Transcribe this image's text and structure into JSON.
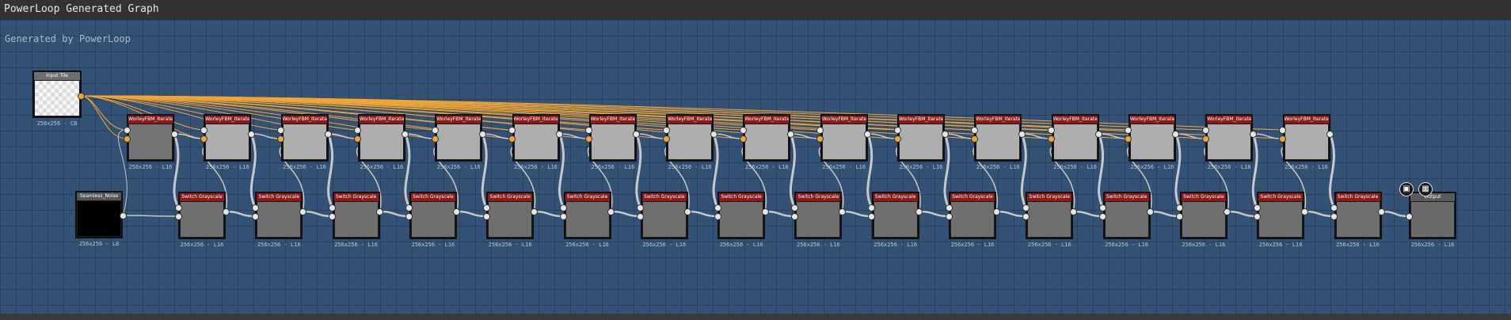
{
  "window": {
    "title": "PowerLoop Generated Graph"
  },
  "canvas": {
    "subtitle": "Generated by PowerLoop",
    "colors": {
      "background": "#345275",
      "blend_header": "#8b1a1a",
      "wire_orange": "#f2a533",
      "wire_gray": "#c8c8c8"
    }
  },
  "input_node": {
    "header": "Input Tile",
    "label": "256x256 - C8",
    "icon": "checkerboard-transparency"
  },
  "seed_node": {
    "header": "Seamless_Noise",
    "label": "256x256 - L8"
  },
  "blend_nodes": [
    {
      "header": "WorleyFBM_Iterate",
      "label": "256x256 - L16"
    },
    {
      "header": "WorleyFBM_Iterate",
      "label": "256x256 - L16"
    },
    {
      "header": "WorleyFBM_Iterate",
      "label": "256x256 - L16"
    },
    {
      "header": "WorleyFBM_Iterate",
      "label": "256x256 - L16"
    },
    {
      "header": "WorleyFBM_Iterate",
      "label": "256x256 - L16"
    },
    {
      "header": "WorleyFBM_Iterate",
      "label": "256x256 - L16"
    },
    {
      "header": "WorleyFBM_Iterate",
      "label": "256x256 - L16"
    },
    {
      "header": "WorleyFBM_Iterate",
      "label": "256x256 - L16"
    },
    {
      "header": "WorleyFBM_Iterate",
      "label": "256x256 - L16"
    },
    {
      "header": "WorleyFBM_Iterate",
      "label": "256x256 - L16"
    },
    {
      "header": "WorleyFBM_Iterate",
      "label": "256x256 - L16"
    },
    {
      "header": "WorleyFBM_Iterate",
      "label": "256x256 - L16"
    },
    {
      "header": "WorleyFBM_Iterate",
      "label": "256x256 - L16"
    },
    {
      "header": "WorleyFBM_Iterate",
      "label": "256x256 - L16"
    },
    {
      "header": "WorleyFBM_Iterate",
      "label": "256x256 - L16"
    },
    {
      "header": "WorleyFBM_Iterate",
      "label": "256x256 - L16"
    }
  ],
  "gray_nodes": [
    {
      "header": "Switch Grayscale",
      "label": "256x256 - L16"
    },
    {
      "header": "Switch Grayscale",
      "label": "256x256 - L16"
    },
    {
      "header": "Switch Grayscale",
      "label": "256x256 - L16"
    },
    {
      "header": "Switch Grayscale",
      "label": "256x256 - L16"
    },
    {
      "header": "Switch Grayscale",
      "label": "256x256 - L16"
    },
    {
      "header": "Switch Grayscale",
      "label": "256x256 - L16"
    },
    {
      "header": "Switch Grayscale",
      "label": "256x256 - L16"
    },
    {
      "header": "Switch Grayscale",
      "label": "256x256 - L16"
    },
    {
      "header": "Switch Grayscale",
      "label": "256x256 - L16"
    },
    {
      "header": "Switch Grayscale",
      "label": "256x256 - L16"
    },
    {
      "header": "Switch Grayscale",
      "label": "256x256 - L16"
    },
    {
      "header": "Switch Grayscale",
      "label": "256x256 - L16"
    },
    {
      "header": "Switch Grayscale",
      "label": "256x256 - L16"
    },
    {
      "header": "Switch Grayscale",
      "label": "256x256 - L16"
    },
    {
      "header": "Switch Grayscale",
      "label": "256x256 - L16"
    },
    {
      "header": "Switch Grayscale",
      "label": "256x256 - L16"
    }
  ],
  "output_node": {
    "header": "Output",
    "label": "256x256 - L16",
    "buttons": [
      {
        "icon": "3d-view-icon"
      },
      {
        "icon": "2d-view-icon"
      }
    ]
  }
}
